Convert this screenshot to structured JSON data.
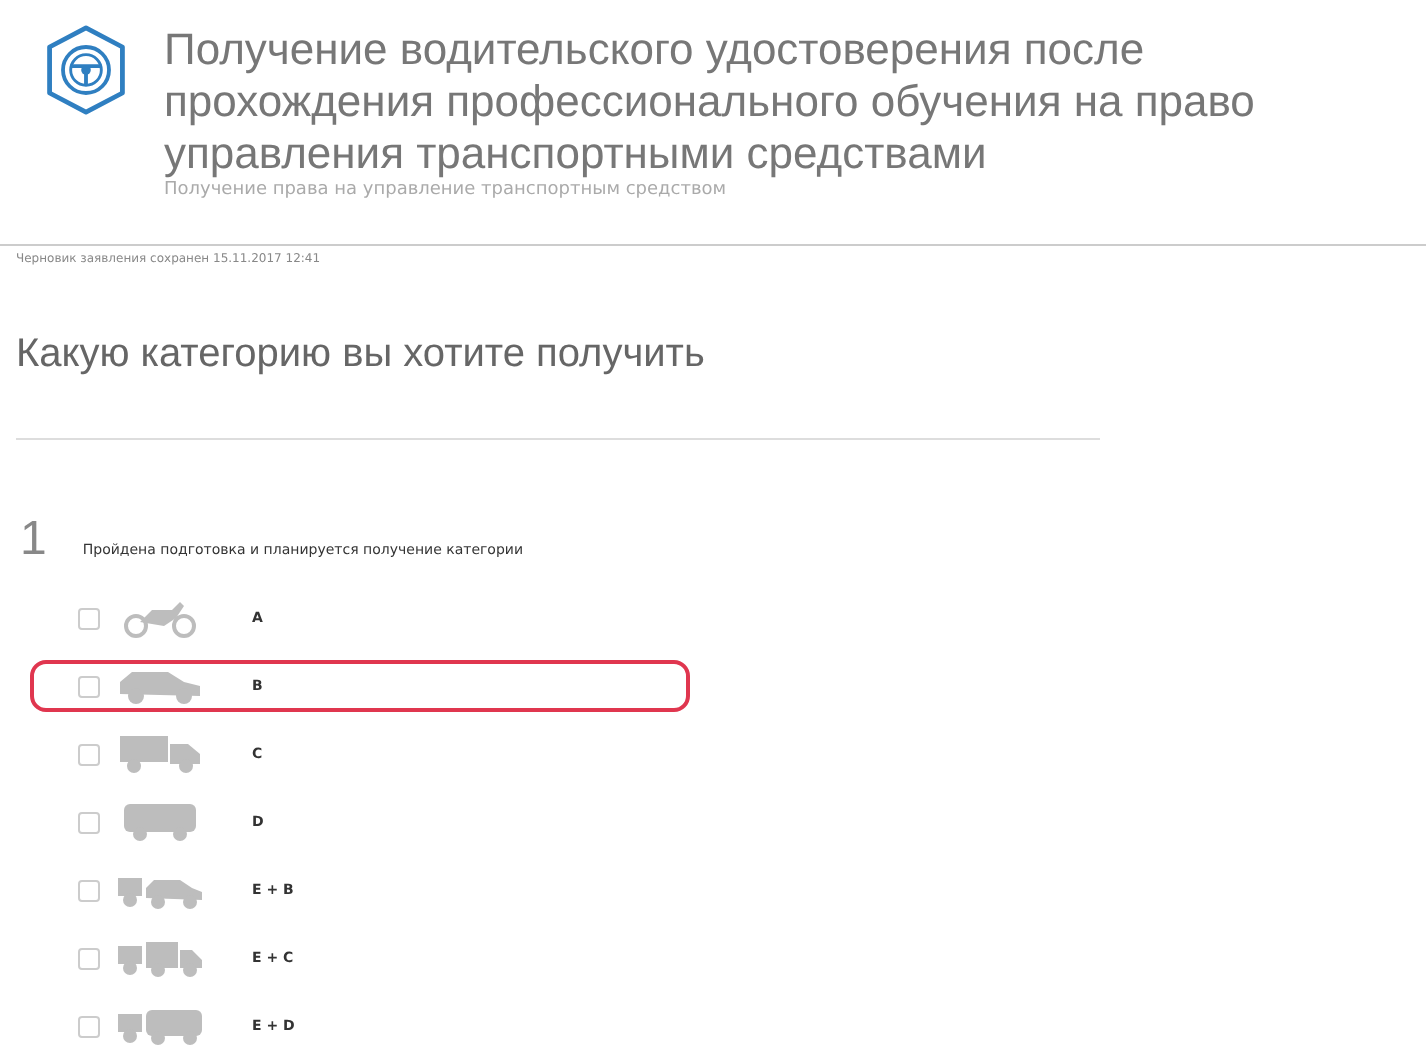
{
  "header": {
    "title": "Получение водительского удостоверения после прохождения профессионального обучения на право управления транспортными средствами",
    "subtitle": "Получение права на управление транспортным средством"
  },
  "draft_note": "Черновик заявления сохранен 15.11.2017 12:41",
  "question": "Какую категорию вы хотите получить",
  "step": {
    "number": "1",
    "text": "Пройдена подготовка и планируется получение категории"
  },
  "categories": [
    {
      "label": "A",
      "kind": "motorcycle",
      "checked": false,
      "highlighted": false
    },
    {
      "label": "B",
      "kind": "car",
      "checked": false,
      "highlighted": true
    },
    {
      "label": "C",
      "kind": "truck",
      "checked": false,
      "highlighted": false
    },
    {
      "label": "D",
      "kind": "bus",
      "checked": false,
      "highlighted": false
    },
    {
      "label": "E + B",
      "kind": "trailer-car",
      "checked": false,
      "highlighted": false
    },
    {
      "label": "E + C",
      "kind": "trailer-truck",
      "checked": false,
      "highlighted": false
    },
    {
      "label": "E + D",
      "kind": "trailer-bus",
      "checked": false,
      "highlighted": false
    }
  ]
}
